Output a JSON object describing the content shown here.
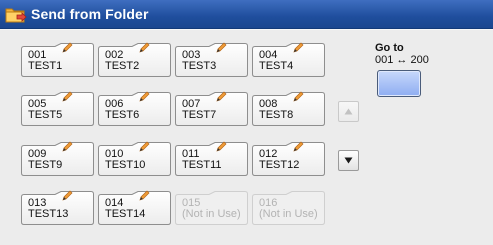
{
  "window": {
    "title": "Send from Folder",
    "title_icon": "folder-send-icon"
  },
  "folders": [
    {
      "number": "001",
      "name": "TEST1",
      "in_use": true
    },
    {
      "number": "002",
      "name": "TEST2",
      "in_use": true
    },
    {
      "number": "003",
      "name": "TEST3",
      "in_use": true
    },
    {
      "number": "004",
      "name": "TEST4",
      "in_use": true
    },
    {
      "number": "005",
      "name": "TEST5",
      "in_use": true
    },
    {
      "number": "006",
      "name": "TEST6",
      "in_use": true
    },
    {
      "number": "007",
      "name": "TEST7",
      "in_use": true
    },
    {
      "number": "008",
      "name": "TEST8",
      "in_use": true
    },
    {
      "number": "009",
      "name": "TEST9",
      "in_use": true
    },
    {
      "number": "010",
      "name": "TEST10",
      "in_use": true
    },
    {
      "number": "011",
      "name": "TEST11",
      "in_use": true
    },
    {
      "number": "012",
      "name": "TEST12",
      "in_use": true
    },
    {
      "number": "013",
      "name": "TEST13",
      "in_use": true
    },
    {
      "number": "014",
      "name": "TEST14",
      "in_use": true
    },
    {
      "number": "015",
      "name": "(Not in Use)",
      "in_use": false
    },
    {
      "number": "016",
      "name": "(Not in Use)",
      "in_use": false
    }
  ],
  "scroll": {
    "up_enabled": false,
    "down_enabled": true
  },
  "goto": {
    "label": "Go to",
    "range": "001 ↔ 200"
  },
  "colors": {
    "title_bar": "#1f4e9d",
    "goto_button": "#a4bdf5",
    "pencil": "#f09c37"
  }
}
